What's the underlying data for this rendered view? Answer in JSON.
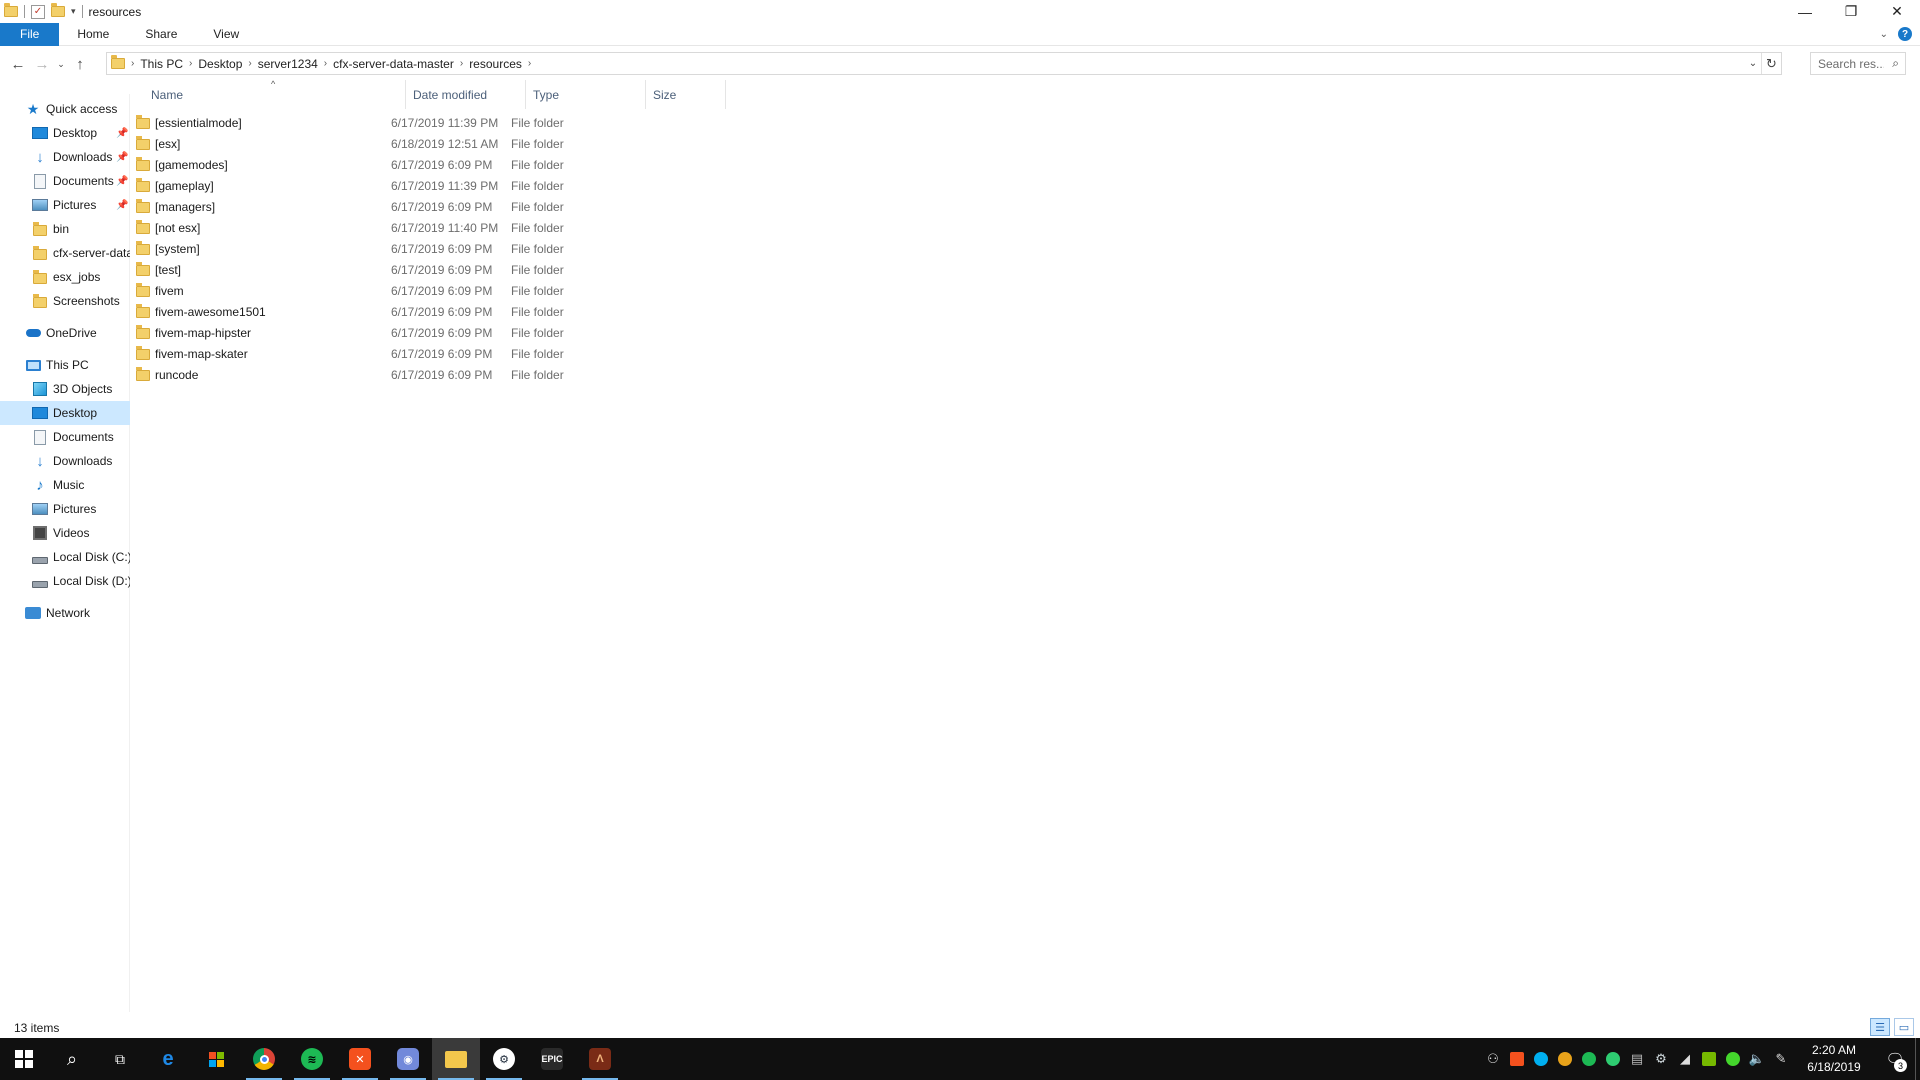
{
  "window": {
    "title": "resources",
    "controls": {
      "minimize": "—",
      "restore": "❐",
      "close": "✕"
    }
  },
  "ribbon": {
    "tabs": [
      "File",
      "Home",
      "Share",
      "View"
    ],
    "help_label": "?"
  },
  "address": {
    "crumbs": [
      "This PC",
      "Desktop",
      "server1234",
      "cfx-server-data-master",
      "resources"
    ]
  },
  "search": {
    "placeholder": "Search res..."
  },
  "sidebar": {
    "quick_access": {
      "label": "Quick access"
    },
    "quick_items": [
      {
        "label": "Desktop",
        "icon": "desktop-icon",
        "pinned": true
      },
      {
        "label": "Downloads",
        "icon": "downloads-icon",
        "pinned": true
      },
      {
        "label": "Documents",
        "icon": "documents-icon",
        "pinned": true
      },
      {
        "label": "Pictures",
        "icon": "pictures-icon",
        "pinned": true
      },
      {
        "label": "bin",
        "icon": "folder-icon",
        "pinned": false
      },
      {
        "label": "cfx-server-data",
        "icon": "folder-icon",
        "pinned": false
      },
      {
        "label": "esx_jobs",
        "icon": "folder-icon",
        "pinned": false
      },
      {
        "label": "Screenshots",
        "icon": "folder-icon",
        "pinned": false
      }
    ],
    "onedrive": {
      "label": "OneDrive"
    },
    "this_pc": {
      "label": "This PC"
    },
    "pc_items": [
      {
        "label": "3D Objects",
        "icon": "3d-objects-icon"
      },
      {
        "label": "Desktop",
        "icon": "desktop-icon",
        "selected": true
      },
      {
        "label": "Documents",
        "icon": "documents-icon"
      },
      {
        "label": "Downloads",
        "icon": "downloads-icon"
      },
      {
        "label": "Music",
        "icon": "music-icon"
      },
      {
        "label": "Pictures",
        "icon": "pictures-icon"
      },
      {
        "label": "Videos",
        "icon": "videos-icon"
      },
      {
        "label": "Local Disk (C:)",
        "icon": "local-disk-icon"
      },
      {
        "label": "Local Disk (D:)",
        "icon": "local-disk-icon"
      }
    ],
    "network": {
      "label": "Network"
    }
  },
  "file_list": {
    "columns": [
      "Name",
      "Date modified",
      "Type",
      "Size"
    ],
    "rows": [
      {
        "name": "[essientialmode]",
        "date": "6/17/2019 11:39 PM",
        "type": "File folder"
      },
      {
        "name": "[esx]",
        "date": "6/18/2019 12:51 AM",
        "type": "File folder"
      },
      {
        "name": "[gamemodes]",
        "date": "6/17/2019 6:09 PM",
        "type": "File folder"
      },
      {
        "name": "[gameplay]",
        "date": "6/17/2019 11:39 PM",
        "type": "File folder"
      },
      {
        "name": "[managers]",
        "date": "6/17/2019 6:09 PM",
        "type": "File folder"
      },
      {
        "name": "[not esx]",
        "date": "6/17/2019 11:40 PM",
        "type": "File folder"
      },
      {
        "name": "[system]",
        "date": "6/17/2019 6:09 PM",
        "type": "File folder"
      },
      {
        "name": "[test]",
        "date": "6/17/2019 6:09 PM",
        "type": "File folder"
      },
      {
        "name": "fivem",
        "date": "6/17/2019 6:09 PM",
        "type": "File folder"
      },
      {
        "name": "fivem-awesome1501",
        "date": "6/17/2019 6:09 PM",
        "type": "File folder"
      },
      {
        "name": "fivem-map-hipster",
        "date": "6/17/2019 6:09 PM",
        "type": "File folder"
      },
      {
        "name": "fivem-map-skater",
        "date": "6/17/2019 6:09 PM",
        "type": "File folder"
      },
      {
        "name": "runcode",
        "date": "6/17/2019 6:09 PM",
        "type": "File folder"
      }
    ]
  },
  "status": {
    "item_count": "13 items"
  },
  "taskbar": {
    "apps": [
      {
        "name": "edge",
        "icon": "edge-icon",
        "color": "#1e88e5",
        "running": false
      },
      {
        "name": "store",
        "icon": "store-icon",
        "color": "#ffffff",
        "running": false
      },
      {
        "name": "chrome",
        "icon": "chrome-icon",
        "color": "#e53935",
        "running": true
      },
      {
        "name": "spotify",
        "icon": "spotify-icon",
        "color": "#1db954",
        "running": true
      },
      {
        "name": "xampp",
        "icon": "xampp-icon",
        "color": "#f4511e",
        "running": true
      },
      {
        "name": "discord",
        "icon": "discord-icon",
        "color": "#7289da",
        "running": true
      },
      {
        "name": "file-explorer",
        "icon": "file-explorer-icon",
        "color": "#f3c74c",
        "running": true,
        "active": true
      },
      {
        "name": "steam",
        "icon": "steam-icon",
        "color": "#1b2838",
        "running": true
      },
      {
        "name": "epic-games",
        "icon": "epic-games-icon",
        "color": "#2a2a2a",
        "running": false,
        "text": "EPIC"
      },
      {
        "name": "app",
        "icon": "app-icon",
        "color": "#7a2b16",
        "running": true
      }
    ],
    "tray_icons": [
      {
        "name": "people",
        "icon": "people-icon",
        "color": "#dddddd"
      },
      {
        "name": "xampp",
        "icon": "xampp-tray-icon",
        "color": "#f4511e"
      },
      {
        "name": "skype",
        "icon": "skype-icon",
        "color": "#00aff0"
      },
      {
        "name": "chrome",
        "icon": "chrome-tray-icon",
        "color": "#e8a21a"
      },
      {
        "name": "spotify",
        "icon": "spotify-tray-icon",
        "color": "#1db954"
      },
      {
        "name": "wechat",
        "icon": "green-tray-icon",
        "color": "#2ecc71"
      },
      {
        "name": "epic",
        "icon": "epic-tray-icon",
        "color": "#bbbbbb"
      },
      {
        "name": "steam",
        "icon": "steam-tray-icon",
        "color": "#cfd8dc"
      },
      {
        "name": "network",
        "icon": "network-tray-icon",
        "color": "#dddddd"
      },
      {
        "name": "nvidia",
        "icon": "nvidia-icon",
        "color": "#76b900"
      },
      {
        "name": "razer",
        "icon": "razer-icon",
        "color": "#44d62c"
      },
      {
        "name": "volume",
        "icon": "volume-icon",
        "color": "#dddddd"
      },
      {
        "name": "pen",
        "icon": "pen-icon",
        "color": "#dddddd"
      }
    ],
    "clock_time": "2:20 AM",
    "clock_date": "6/18/2019",
    "notification_count": "3"
  }
}
